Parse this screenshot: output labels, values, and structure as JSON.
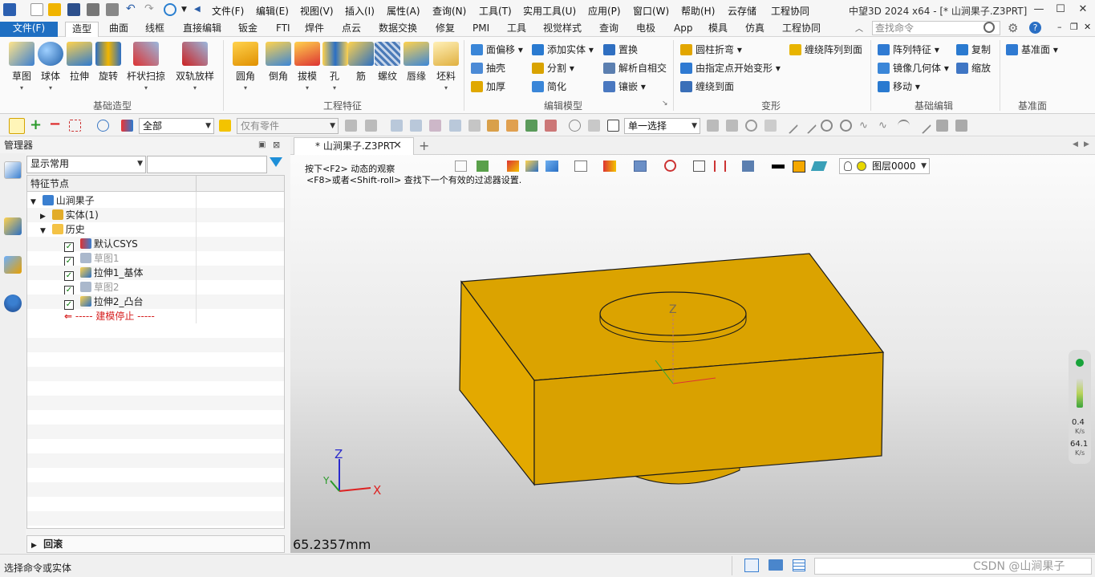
{
  "app": {
    "title": "中望3D 2024 x64 - [* 山涧果子.Z3PRT]"
  },
  "menu": [
    "文件(F)",
    "编辑(E)",
    "视图(V)",
    "插入(I)",
    "属性(A)",
    "查询(N)",
    "工具(T)",
    "实用工具(U)",
    "应用(P)",
    "窗口(W)",
    "帮助(H)",
    "云存储",
    "工程协同"
  ],
  "tabs": [
    "文件(F)",
    "造型",
    "曲面",
    "线框",
    "直接编辑",
    "钣金",
    "FTI",
    "焊件",
    "点云",
    "数据交换",
    "修复",
    "PMI",
    "工具",
    "视觉样式",
    "查询",
    "电极",
    "App",
    "模具",
    "仿真",
    "工程协同"
  ],
  "search": {
    "placeholder": "查找命令"
  },
  "ribbon": {
    "basic": [
      "草图",
      "球体",
      "拉伸",
      "旋转",
      "杆状扫掠",
      "双轨放样"
    ],
    "basic_group": "基础造型",
    "feature": [
      "圆角",
      "倒角",
      "拔模",
      "孔",
      "筋",
      "螺纹",
      "唇缘",
      "坯料"
    ],
    "feature_group": "工程特征",
    "edit": [
      "面偏移",
      "抽壳",
      "加厚",
      "添加实体",
      "分割",
      "简化",
      "置换",
      "解析自相交",
      "镶嵌"
    ],
    "edit_group": "编辑模型",
    "deform": [
      "圆柱折弯",
      "由指定点开始变形",
      "缠绕到面",
      "缠绕阵列到面"
    ],
    "deform_group": "变形",
    "base_edit": [
      "阵列特征",
      "镜像几何体",
      "移动",
      "复制",
      "缩放"
    ],
    "base_edit_group": "基础编辑",
    "datum": [
      "基准面"
    ],
    "datum_group": "基准面"
  },
  "toolbar2": {
    "filter": "全部",
    "parts": "仅有零件",
    "select_mode": "单一选择"
  },
  "manager": {
    "title": "管理器",
    "display": "显示常用",
    "tree_header": "特征节点",
    "root": "山涧果子",
    "items": [
      "实体(1)",
      "历史",
      "默认CSYS",
      "草图1",
      "拉伸1_基体",
      "草图2",
      "拉伸2_凸台"
    ],
    "stop": "----- 建模停止 -----",
    "rollback": "回滚"
  },
  "document": {
    "tab": "* 山涧果子.Z3PRT",
    "hint1": "按下<F2> 动态的观察",
    "hint2": "<F8>或者<Shift-roll> 查找下一个有效的过滤器设置.",
    "layer": "图层0000",
    "scale": "65.2357mm"
  },
  "net": {
    "up_value": "0.4",
    "up_unit": "K/s",
    "down_value": "64.1",
    "down_unit": "K/s"
  },
  "status": {
    "prompt": "选择命令或实体",
    "watermark": "CSDN @山涧果子"
  },
  "colors": {
    "accent": "#1f6fc2",
    "part": "#dba300",
    "part_edge": "#1a1a1a"
  }
}
